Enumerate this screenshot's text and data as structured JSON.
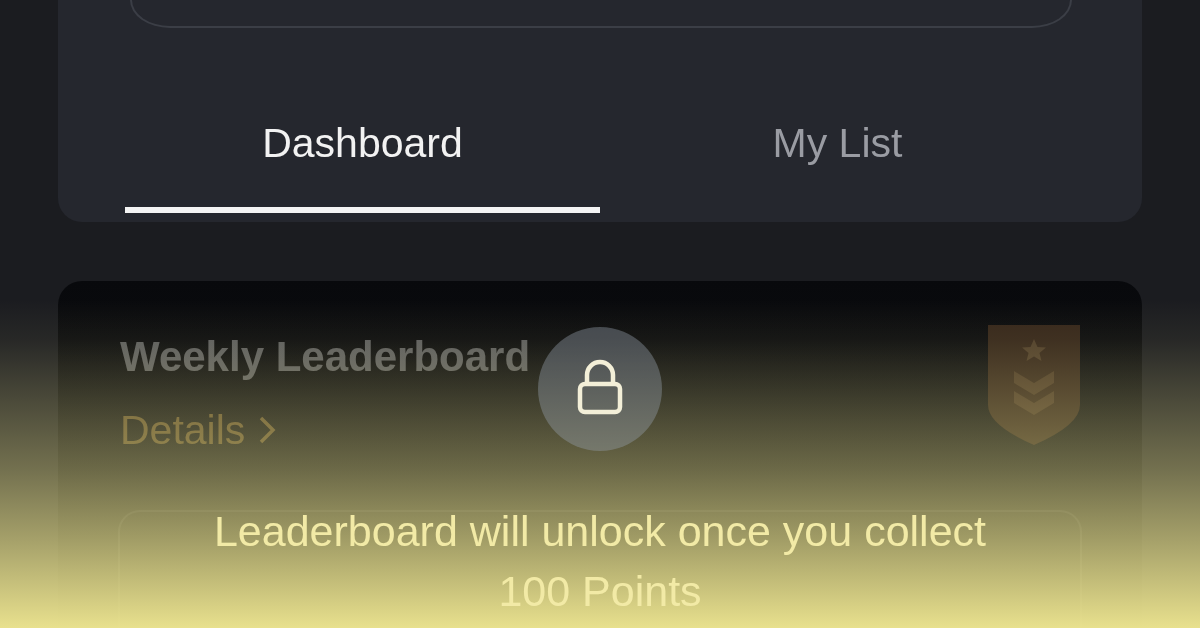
{
  "tabs": [
    {
      "label": "Dashboard",
      "selected": true
    },
    {
      "label": "My List",
      "selected": false
    }
  ],
  "leaderboard_card": {
    "title": "Weekly Leaderboard",
    "link": "Details",
    "locked": true
  },
  "lock_overlay": {
    "message": "Leaderboard will unlock once you collect 100 Points"
  }
}
